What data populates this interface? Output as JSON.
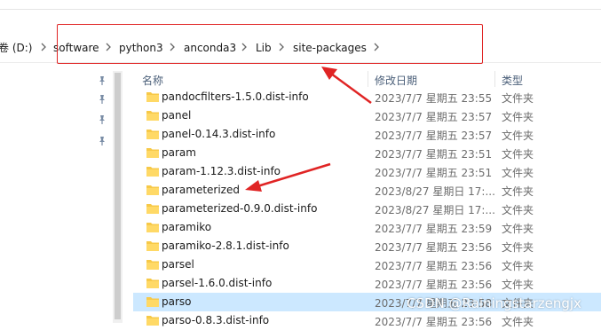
{
  "address_bar": {
    "crumbs": [
      "卷 (D:)",
      "software",
      "python3",
      "anconda3",
      "Lib",
      "site-packages"
    ]
  },
  "columns": {
    "name": "名称",
    "modified": "修改日期",
    "type": "类型"
  },
  "files": [
    {
      "name": "pandocfilters-1.5.0.dist-info",
      "date": "2023/7/7 星期五 23:55",
      "type": "文件夹"
    },
    {
      "name": "panel",
      "date": "2023/7/7 星期五 23:57",
      "type": "文件夹"
    },
    {
      "name": "panel-0.14.3.dist-info",
      "date": "2023/7/7 星期五 23:57",
      "type": "文件夹"
    },
    {
      "name": "param",
      "date": "2023/7/7 星期五 23:51",
      "type": "文件夹"
    },
    {
      "name": "param-1.12.3.dist-info",
      "date": "2023/7/7 星期五 23:51",
      "type": "文件夹"
    },
    {
      "name": "parameterized",
      "date": "2023/8/27 星期日 17:...",
      "type": "文件夹"
    },
    {
      "name": "parameterized-0.9.0.dist-info",
      "date": "2023/8/27 星期日 17:...",
      "type": "文件夹"
    },
    {
      "name": "paramiko",
      "date": "2023/7/7 星期五 23:59",
      "type": "文件夹"
    },
    {
      "name": "paramiko-2.8.1.dist-info",
      "date": "2023/7/7 星期五 23:56",
      "type": "文件夹"
    },
    {
      "name": "parsel",
      "date": "2023/7/7 星期五 23:56",
      "type": "文件夹"
    },
    {
      "name": "parsel-1.6.0.dist-info",
      "date": "2023/7/7 星期五 23:56",
      "type": "文件夹"
    },
    {
      "name": "parso",
      "date": "2023/7/7 星期五 23:58",
      "type": "文件夹"
    },
    {
      "name": "parso-0.8.3.dist-info",
      "date": "2023/7/7 星期五 23:56",
      "type": "文件夹"
    }
  ],
  "selected_index": 11,
  "watermark": "CSDN @Rainingstarzengjx",
  "colors": {
    "annotation_red": "#e02424",
    "selection": "#cce8ff",
    "folder": "#f7c948"
  }
}
